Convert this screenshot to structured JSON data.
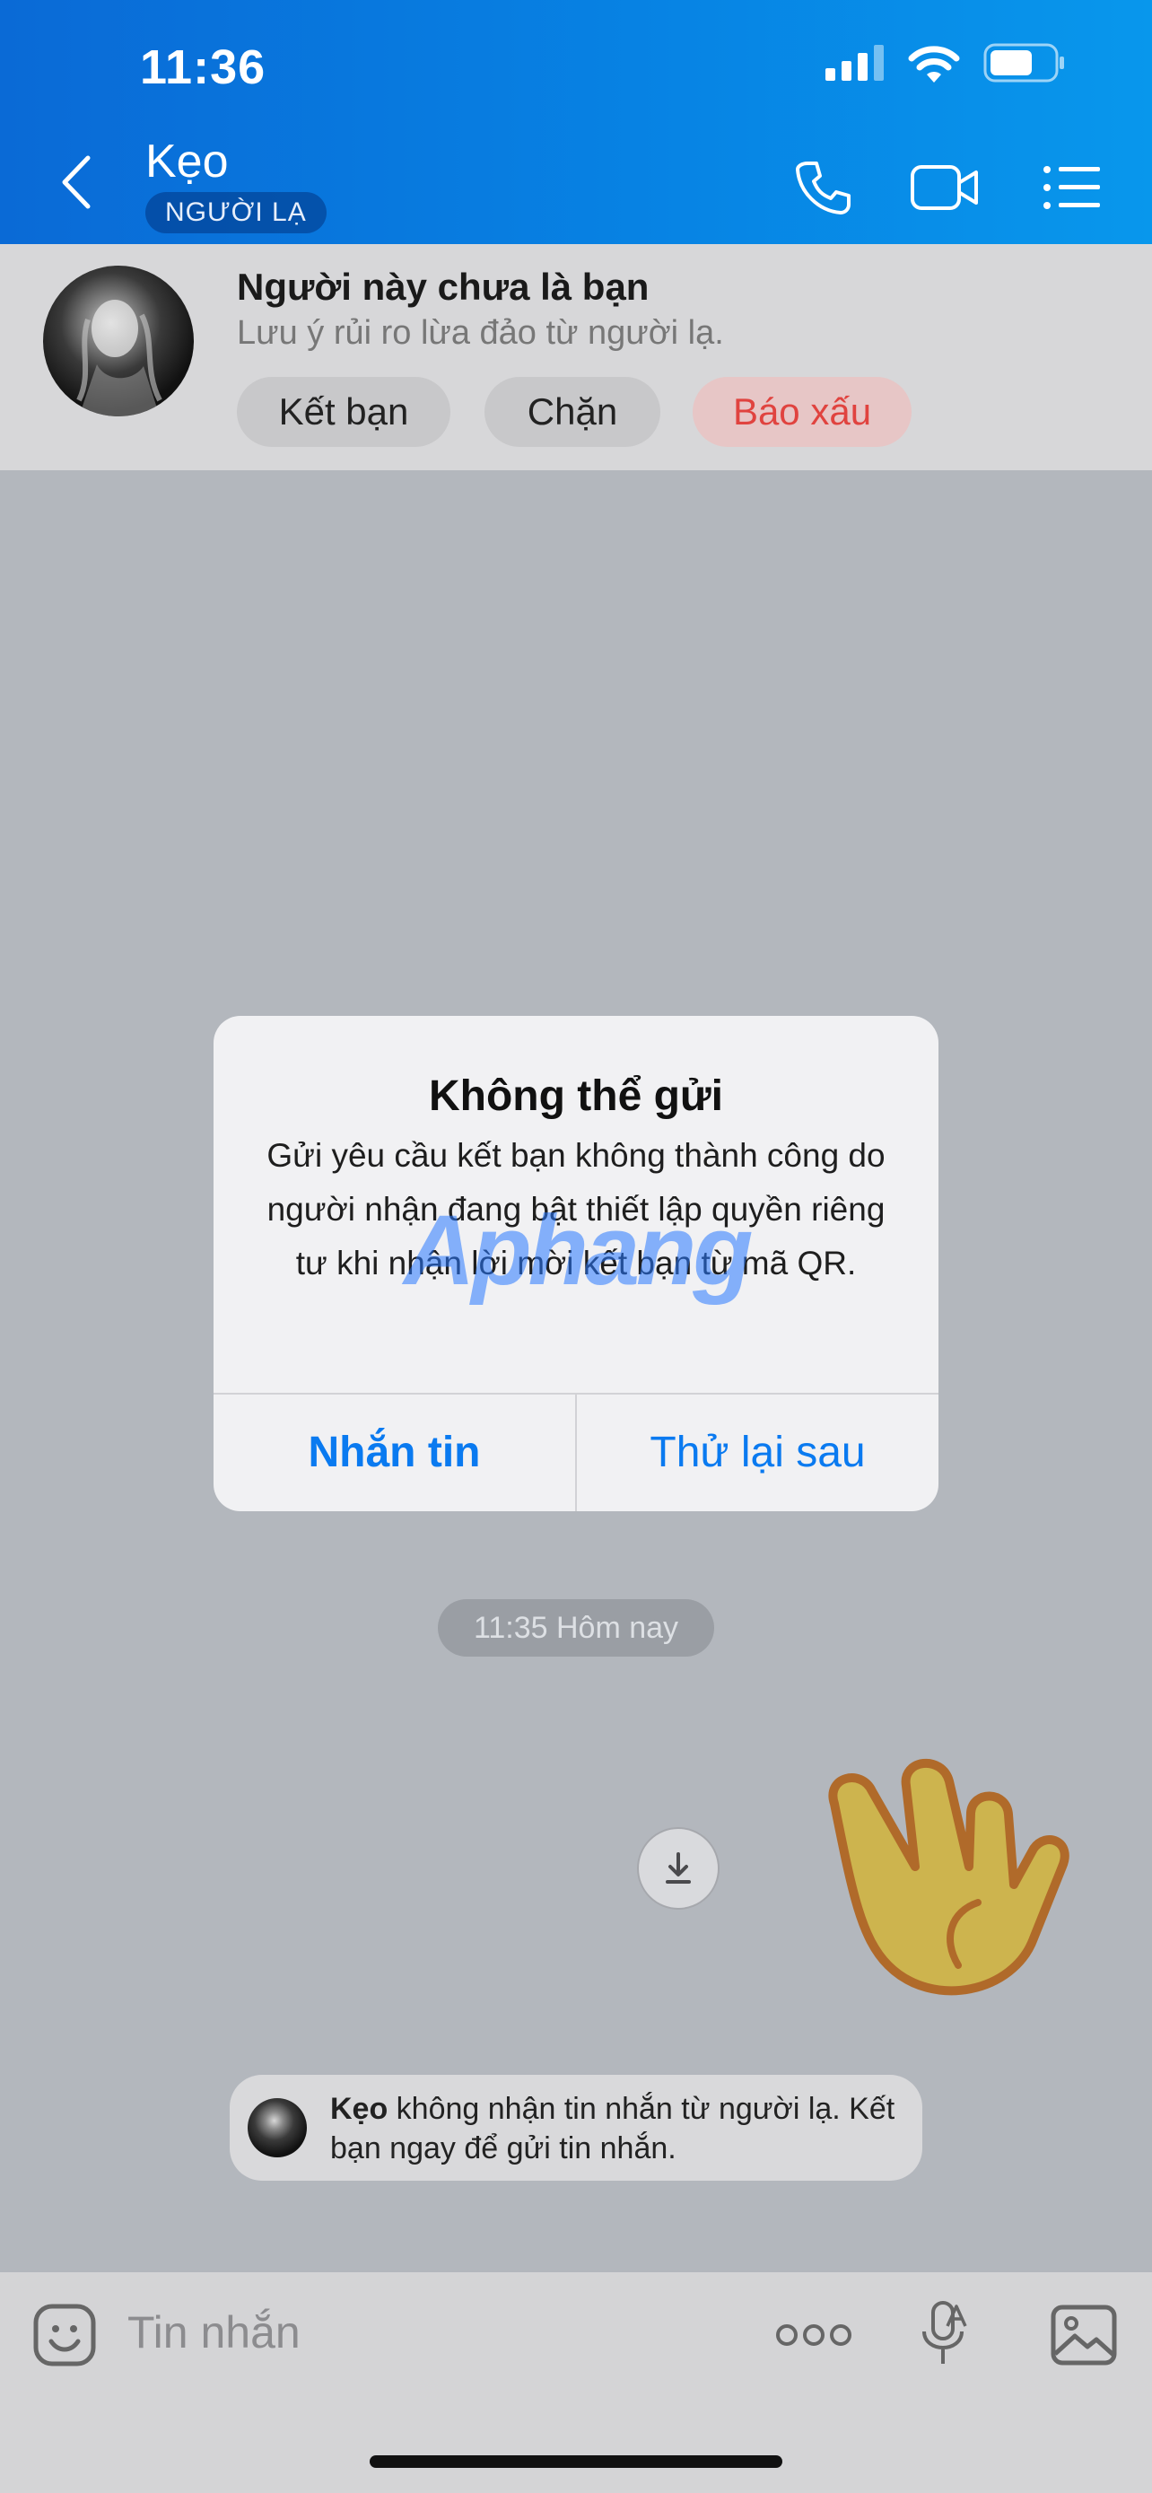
{
  "status_bar": {
    "time": "11:36"
  },
  "header": {
    "contact_name": "Kẹo",
    "badge": "NGƯỜI LẠ",
    "icons": [
      "back-chevron-icon",
      "phone-icon",
      "video-camera-icon",
      "list-menu-icon"
    ]
  },
  "banner": {
    "title": "Người này chưa là bạn",
    "subtitle": "Lưu ý rủi ro lừa đảo từ người lạ.",
    "add_friend": "Kết bạn",
    "block": "Chặn",
    "report": "Báo xấu",
    "report_color": "#e0433f"
  },
  "dialog": {
    "title": "Không thể gửi",
    "message": "Gửi yêu cầu kết bạn không thành công do người nhận đang bật thiết lập quyền riêng tư khi nhận lời mời kết bạn từ mã QR.",
    "primary_button": "Nhắn tin",
    "secondary_button": "Thử lại sau",
    "button_color": "#0a7af0"
  },
  "watermark": "Aphang",
  "chat": {
    "timestamp": "11:35 Hôm nay",
    "sticker": "waving-hand-sticker",
    "notice_name": "Kẹo",
    "notice_text": " không nhận tin nhắn từ người lạ. Kết bạn ngay để gửi tin nhắn."
  },
  "input_bar": {
    "placeholder": "Tin nhắn",
    "icons": [
      "emoji-sticker-icon",
      "more-dots-icon",
      "voice-to-text-mic-icon",
      "image-gallery-icon"
    ]
  }
}
